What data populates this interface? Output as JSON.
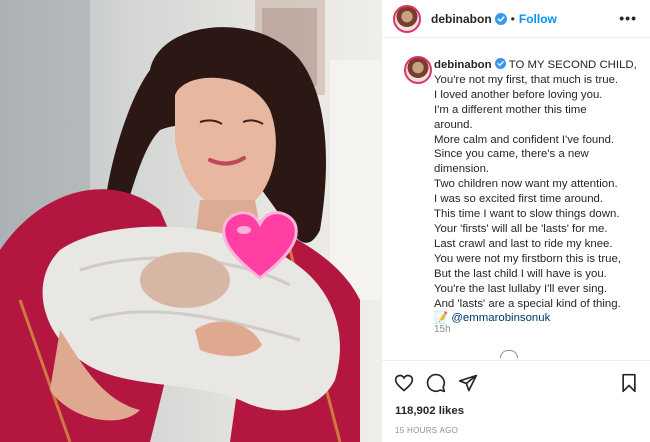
{
  "post": {
    "username": "debinabon",
    "dot": "•",
    "follow_label": "Follow",
    "more_label": "•••",
    "caption_lines": [
      "TO MY SECOND CHILD,",
      "You're not my first, that much is true.",
      "I loved another before loving you.",
      "I'm a different mother this time",
      "around.",
      "More calm and confident I've found.",
      "Since you came, there's a new",
      "dimension.",
      "Two children now want my attention.",
      "I was so excited first time around.",
      "This time I want to slow things down.",
      "Your 'firsts' will all be 'lasts' for me.",
      "Last crawl and last to ride my knee.",
      "You were not my firstborn this is true,",
      "But the last child I will have is you.",
      "You're the last lullaby I'll ever sing.",
      "And 'lasts' are a special kind of thing."
    ],
    "credit_emoji": "📝",
    "credit_mention": "@emmarobinsonuk",
    "caption_time": "15h",
    "likes": "118,902 likes",
    "time_ago": "15 HOURS AGO"
  },
  "colors": {
    "accent": "#0095f6",
    "verified": "#3897f0",
    "mention": "#00376b",
    "muted": "#8e8e8e",
    "saree": "#b3173f"
  },
  "icons": [
    "verified-badge-icon",
    "heart-icon",
    "comment-icon",
    "share-icon",
    "bookmark-icon",
    "heart-emoji-icon"
  ]
}
